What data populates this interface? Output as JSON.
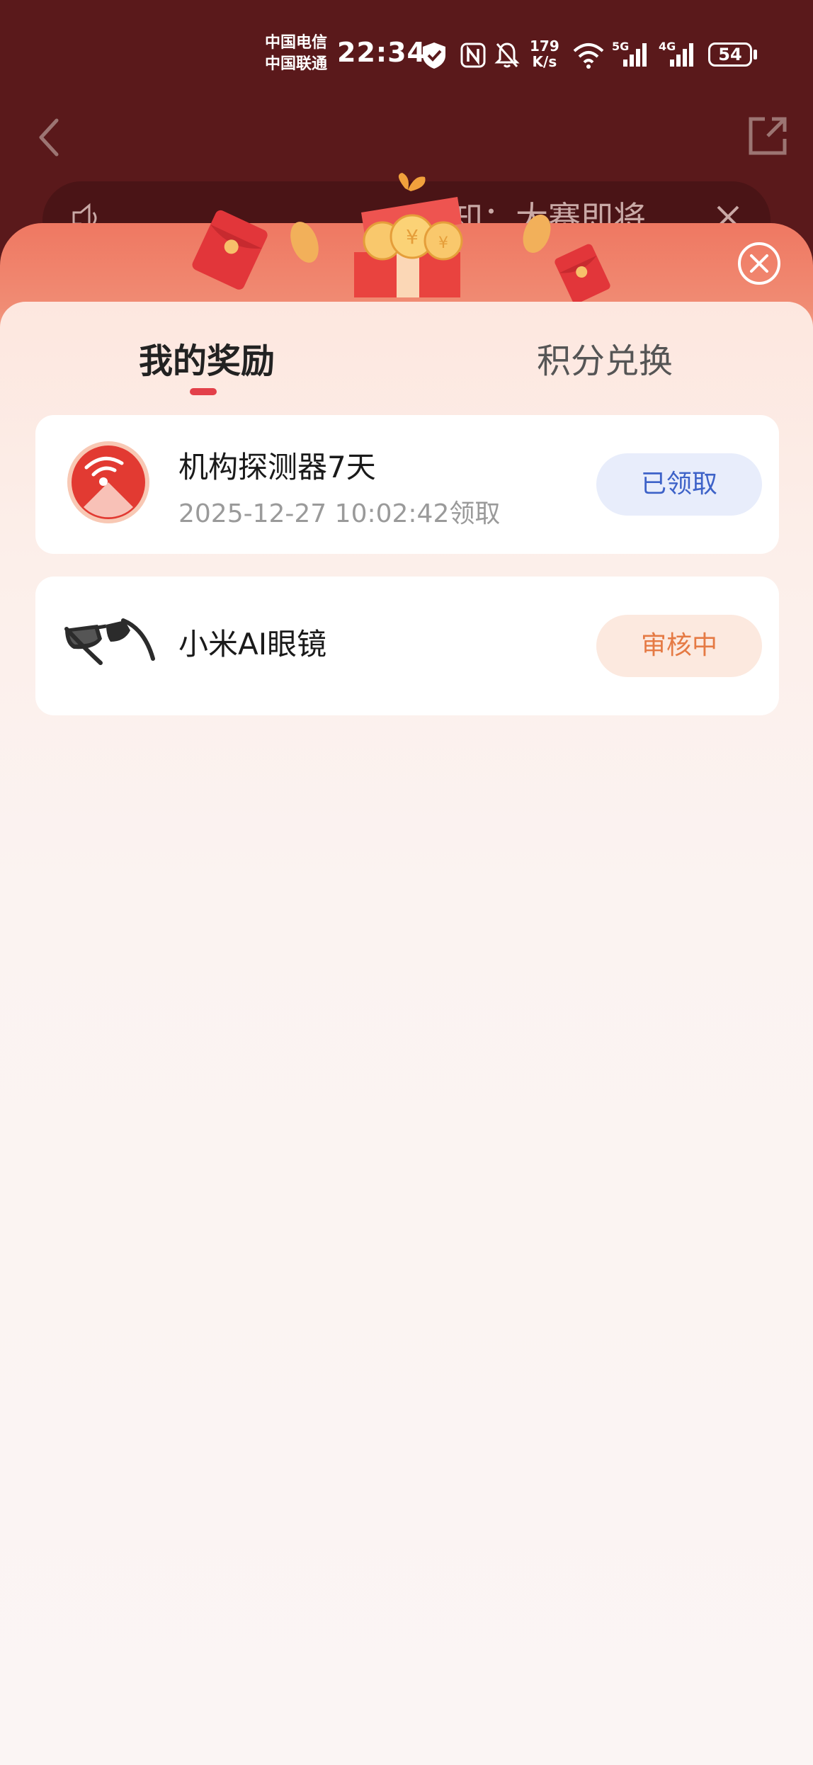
{
  "status_bar": {
    "carrier_1": "中国电信",
    "carrier_2": "中国联通",
    "time": "22:34",
    "net_speed_value": "179",
    "net_speed_unit": "K/s",
    "signal_1_label": "5G",
    "signal_2_label": "4G",
    "battery": "54"
  },
  "notice": {
    "text": "通知：大赛即将"
  },
  "tabs": [
    {
      "label": "我的奖励",
      "active": true
    },
    {
      "label": "积分兑换",
      "active": false
    }
  ],
  "rewards": [
    {
      "title": "机构探测器7天",
      "subtitle": "2025-12-27 10:02:42领取",
      "status": "已领取",
      "icon": "radar-detector-icon"
    },
    {
      "title": "小米AI眼镜",
      "subtitle": "",
      "status": "审核中",
      "icon": "glasses-icon"
    }
  ],
  "colors": {
    "header_bg": "#5a191b",
    "accent_red": "#e3404a",
    "claimed_text": "#3d62c8",
    "review_text": "#e57a44"
  }
}
